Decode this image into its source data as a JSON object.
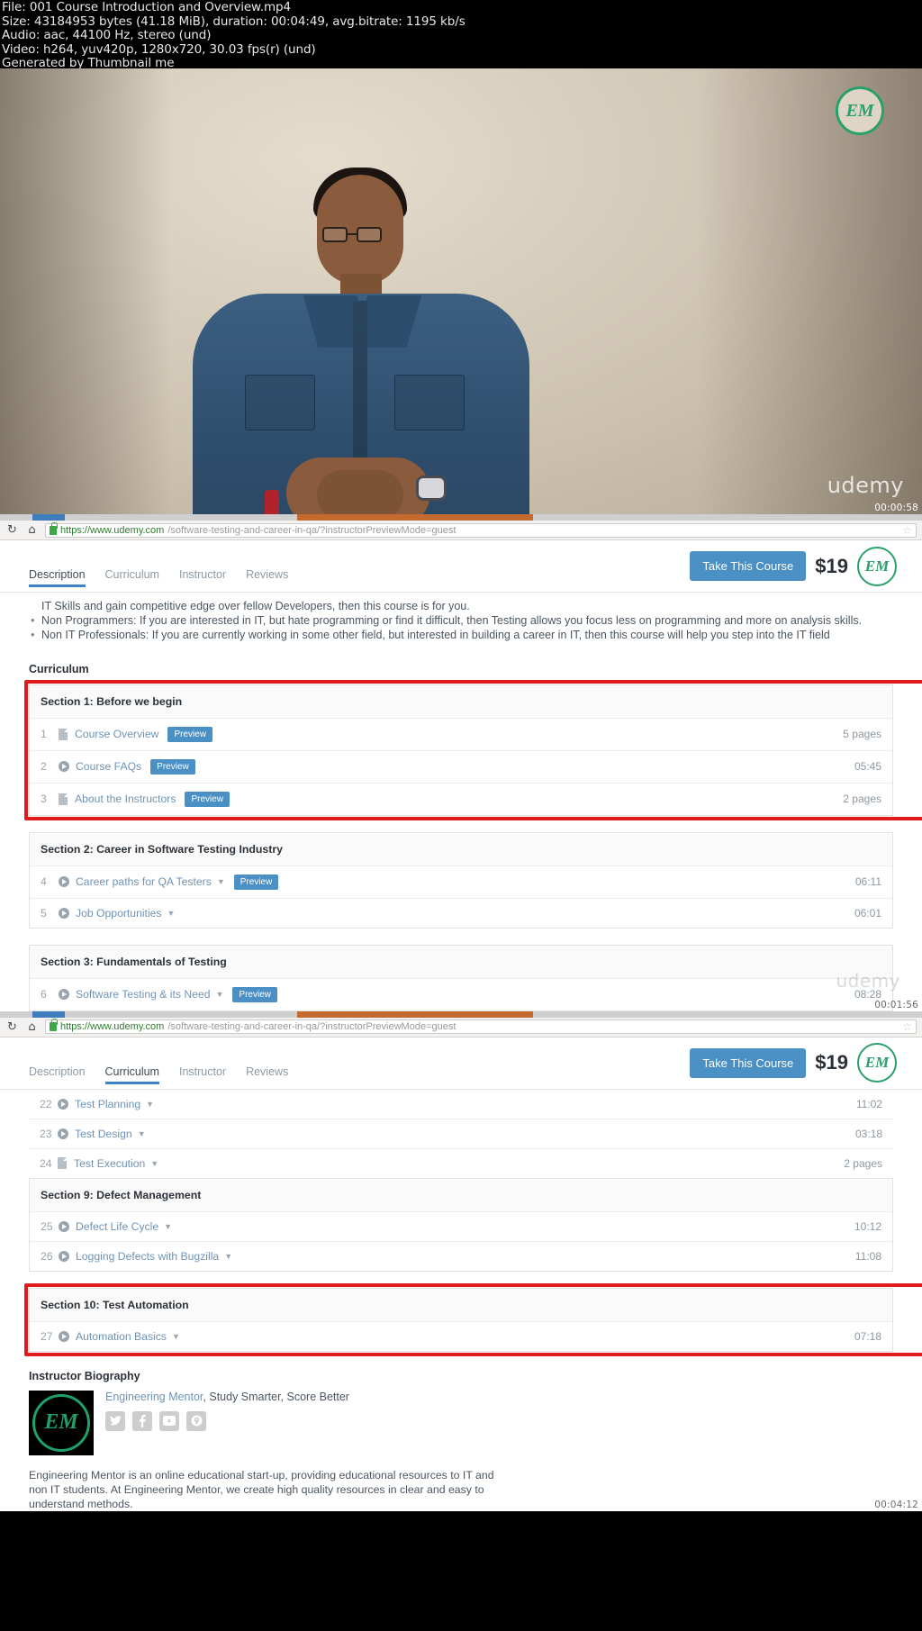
{
  "video_meta": {
    "file": "File: 001 Course Introduction and Overview.mp4",
    "size": "Size: 43184953 bytes (41.18 MiB), duration: 00:04:49, avg.bitrate: 1195 kb/s",
    "audio": "Audio: aac, 44100 Hz, stereo (und)",
    "video": "Video: h264, yuv420p, 1280x720, 30.03 fps(r) (und)",
    "generated": "Generated by Thumbnail me"
  },
  "video_frame": {
    "logo_text": "EM",
    "brand": "udemy",
    "timestamp": "00:00:58"
  },
  "panel1": {
    "url": {
      "domain": "https://www.udemy.com",
      "rest": "/software-testing-and-career-in-qa/?instructorPreviewMode=guest",
      "reload_icon": "↻",
      "home_icon": "⌂",
      "lock_icon": "lock-icon",
      "star_icon": "☆"
    },
    "tabs": [
      {
        "label": "Description",
        "active": true
      },
      {
        "label": "Curriculum",
        "active": false
      },
      {
        "label": "Instructor",
        "active": false
      },
      {
        "label": "Reviews",
        "active": false
      }
    ],
    "take_course_label": "Take This Course",
    "price": "$19",
    "em_badge": "EM",
    "bullets": [
      "IT Skills and gain competitive edge over fellow Developers, then this course is for you.",
      "Non Programmers: If you are interested in IT, but hate programming or find it difficult, then Testing allows you focus less on programming and more on analysis skills.",
      "Non IT Professionals: If you are currently working in some other field, but interested in building a career in IT, then this course will help you step into the IT field"
    ],
    "curriculum_heading": "Curriculum",
    "sections": [
      {
        "title": "Section 1: Before we begin",
        "highlighted": true,
        "lectures": [
          {
            "num": "1",
            "icon": "document-icon",
            "title": "Course Overview",
            "caret": false,
            "preview": "Preview",
            "duration": "5 pages"
          },
          {
            "num": "2",
            "icon": "play-icon",
            "title": "Course FAQs",
            "caret": false,
            "preview": "Preview",
            "duration": "05:45"
          },
          {
            "num": "3",
            "icon": "document-icon",
            "title": "About the Instructors",
            "caret": false,
            "preview": "Preview",
            "duration": "2 pages"
          }
        ]
      },
      {
        "title": "Section 2: Career in Software Testing Industry",
        "highlighted": false,
        "lectures": [
          {
            "num": "4",
            "icon": "play-icon",
            "title": "Career paths for QA Testers",
            "caret": true,
            "preview": "Preview",
            "duration": "06:11"
          },
          {
            "num": "5",
            "icon": "play-icon",
            "title": "Job Opportunities",
            "caret": true,
            "preview": "",
            "duration": "06:01"
          }
        ]
      },
      {
        "title": "Section 3: Fundamentals of Testing",
        "highlighted": false,
        "lectures": [
          {
            "num": "6",
            "icon": "play-icon",
            "title": "Software Testing & its Need",
            "caret": true,
            "preview": "Preview",
            "duration": "08:28"
          }
        ]
      }
    ],
    "watermark": "udemy",
    "timestamp": "00:01:56"
  },
  "panel2": {
    "url": {
      "domain": "https://www.udemy.com",
      "rest": "/software-testing-and-career-in-qa/?instructorPreviewMode=guest",
      "reload_icon": "↻",
      "home_icon": "⌂",
      "lock_icon": "lock-icon",
      "star_icon": "☆"
    },
    "tabs": [
      {
        "label": "Description",
        "active": false
      },
      {
        "label": "Curriculum",
        "active": true
      },
      {
        "label": "Instructor",
        "active": false
      },
      {
        "label": "Reviews",
        "active": false
      }
    ],
    "take_course_label": "Take This Course",
    "price": "$19",
    "em_badge": "EM",
    "top_lectures": [
      {
        "num": "22",
        "icon": "play-icon",
        "title": "Test Planning",
        "caret": true,
        "preview": "",
        "duration": "11:02"
      },
      {
        "num": "23",
        "icon": "play-icon",
        "title": "Test Design",
        "caret": true,
        "preview": "",
        "duration": "03:18"
      },
      {
        "num": "24",
        "icon": "document-icon",
        "title": "Test Execution",
        "caret": true,
        "preview": "",
        "duration": "2 pages"
      }
    ],
    "sections": [
      {
        "title": "Section 9: Defect Management",
        "highlighted": false,
        "lectures": [
          {
            "num": "25",
            "icon": "play-icon",
            "title": "Defect Life Cycle",
            "caret": true,
            "preview": "",
            "duration": "10:12"
          },
          {
            "num": "26",
            "icon": "play-icon",
            "title": "Logging Defects with Bugzilla",
            "caret": true,
            "preview": "",
            "duration": "11:08"
          }
        ]
      },
      {
        "title": "Section 10: Test Automation",
        "highlighted": true,
        "lectures": [
          {
            "num": "27",
            "icon": "play-icon",
            "title": "Automation Basics",
            "caret": true,
            "preview": "",
            "duration": "07:18"
          }
        ]
      }
    ],
    "bio": {
      "heading": "Instructor Biography",
      "logo": "EM",
      "name": "Engineering Mentor",
      "tagline": ", Study Smarter, Score Better",
      "socials": [
        {
          "name": "twitter-icon",
          "glyph": "ᴠ"
        },
        {
          "name": "facebook-icon",
          "glyph": "f"
        },
        {
          "name": "youtube-icon",
          "glyph": "▶"
        },
        {
          "name": "location-icon",
          "glyph": "◉"
        }
      ],
      "paragraph": "Engineering Mentor is an online educational start-up, providing educational resources to IT and non IT students. At Engineering Mentor, we create high quality resources in clear and easy to understand methods."
    },
    "timestamp": "00:04:12"
  },
  "colors": {
    "accent_blue": "#4a90c4",
    "link_blue": "#6f93b5",
    "highlight_red": "#e01b1b",
    "brand_green": "#2aa06a"
  }
}
